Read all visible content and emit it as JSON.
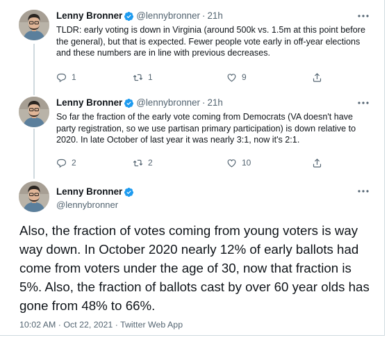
{
  "tweets": [
    {
      "name": "Lenny Bronner",
      "handle": "@lennybronner",
      "separator": "·",
      "time": "21h",
      "text": "TLDR: early voting is down in Virginia (around 500k vs. 1.5m at this point before the general), but that is expected. Fewer people vote early in off-year elections and these numbers are in line with previous decreases.",
      "replies": "1",
      "retweets": "1",
      "likes": "9"
    },
    {
      "name": "Lenny Bronner",
      "handle": "@lennybronner",
      "separator": "·",
      "time": "21h",
      "text": "So far the fraction of the early vote coming from Democrats (VA doesn't have party registration, so we use partisan primary participation) is down relative to 2020. In late October of last year it was nearly 3:1, now it's 2:1.",
      "replies": "2",
      "retweets": "2",
      "likes": "10"
    }
  ],
  "main_tweet": {
    "name": "Lenny Bronner",
    "handle": "@lennybronner",
    "text": "Also, the fraction of votes coming from young voters is way way down. In October 2020 nearly 12% of early ballots had come from voters under the age of 30, now that fraction is 5%. Also, the fraction of ballots cast by over 60 year olds has gone from 48% to 66%.",
    "timestamp": "10:02 AM · Oct 22, 2021 · Twitter Web App"
  },
  "colors": {
    "text_primary": "#0f1419",
    "text_secondary": "#536471",
    "verified_blue": "#1d9bf0",
    "thread_line": "#cfd9de"
  },
  "icons": {
    "verified": "verified-badge-icon",
    "more": "more-dots-icon",
    "reply": "reply-bubble-icon",
    "retweet": "retweet-icon",
    "like": "heart-icon",
    "share": "share-upload-icon"
  }
}
